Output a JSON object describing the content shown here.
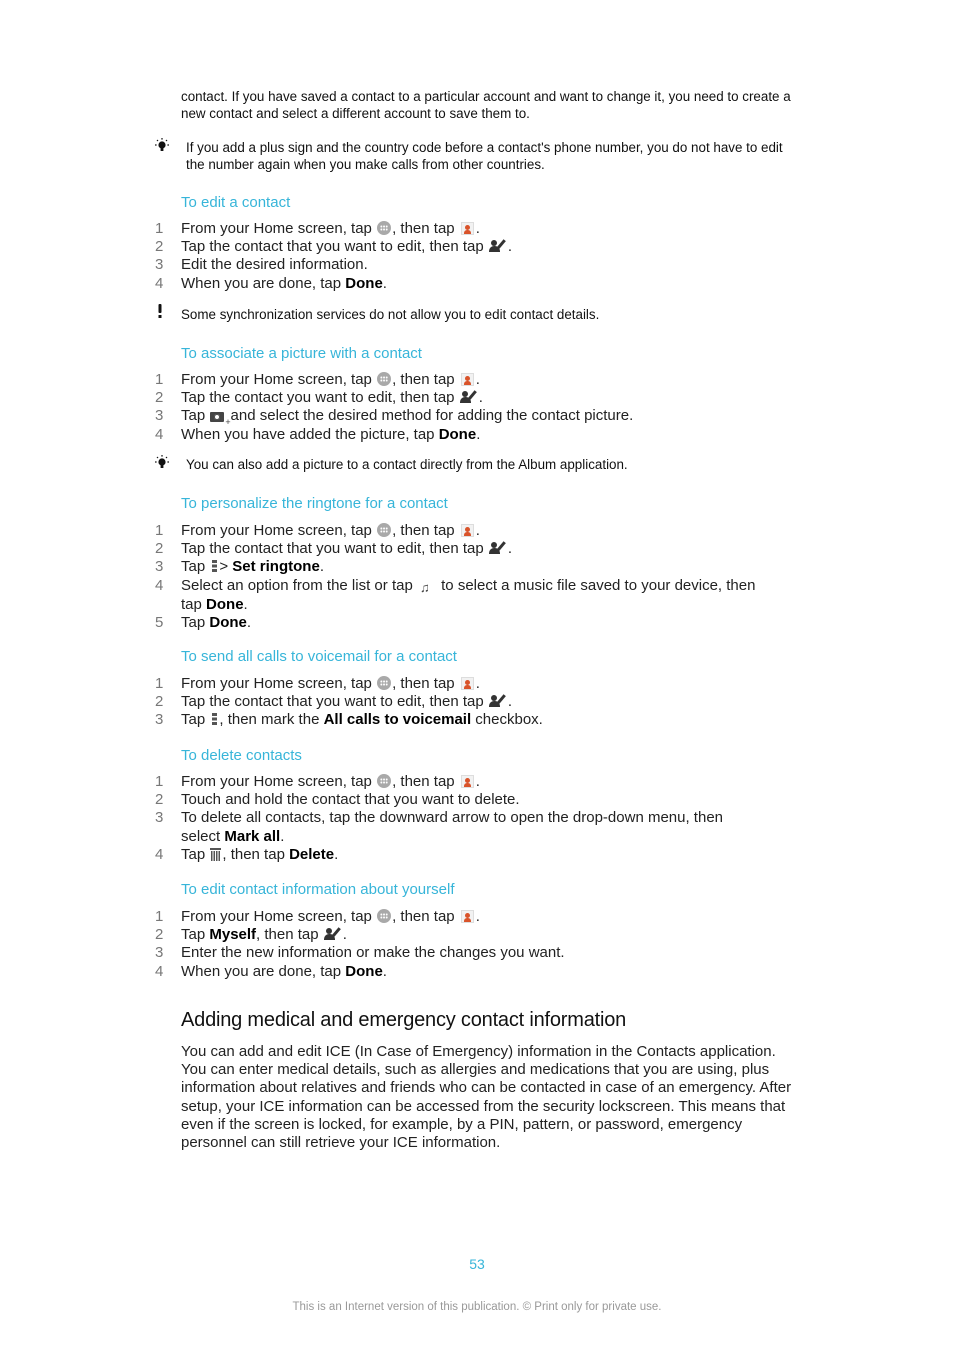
{
  "intro": {
    "text": "contact. If you have saved a contact to a particular account and want to change it, you need to create a new contact and select a different account to save them to."
  },
  "tip1": {
    "icon": "lightbulb-icon",
    "text": "If you add a plus sign and the country code before a contact's phone number, you do not have to edit the number again when you make calls from other countries."
  },
  "sections": [
    {
      "title": "To edit a contact",
      "steps": [
        {
          "num": "1",
          "parts": [
            "From your Home screen, tap ",
            {
              "icon": "apps-icon"
            },
            ", then tap ",
            {
              "icon": "contacts-icon"
            },
            "."
          ]
        },
        {
          "num": "2",
          "parts": [
            "Tap the contact that you want to edit, then tap ",
            {
              "icon": "edit-contact-icon"
            },
            "."
          ]
        },
        {
          "num": "3",
          "parts": [
            "Edit the desired information."
          ]
        },
        {
          "num": "4",
          "parts": [
            "When you are done, tap ",
            {
              "bold": "Done"
            },
            "."
          ]
        }
      ]
    },
    {
      "title": "To associate a picture with a contact",
      "steps": [
        {
          "num": "1",
          "parts": [
            "From your Home screen, tap ",
            {
              "icon": "apps-icon"
            },
            ", then tap ",
            {
              "icon": "contacts-icon"
            },
            "."
          ]
        },
        {
          "num": "2",
          "parts": [
            "Tap the contact you want to edit, then tap ",
            {
              "icon": "edit-contact-icon"
            },
            "."
          ]
        },
        {
          "num": "3",
          "parts": [
            "Tap ",
            {
              "icon": "add-camera-icon"
            },
            " and select the desired method for adding the contact picture."
          ]
        },
        {
          "num": "4",
          "parts": [
            "When you have added the picture, tap ",
            {
              "bold": "Done"
            },
            "."
          ]
        }
      ]
    },
    {
      "title": "To personalize the ringtone for a contact",
      "steps": [
        {
          "num": "1",
          "parts": [
            "From your Home screen, tap ",
            {
              "icon": "apps-icon"
            },
            ", then tap ",
            {
              "icon": "contacts-icon"
            },
            "."
          ]
        },
        {
          "num": "2",
          "parts": [
            "Tap the contact that you want to edit, then tap ",
            {
              "icon": "edit-contact-icon"
            },
            "."
          ]
        },
        {
          "num": "3",
          "parts": [
            "Tap ",
            {
              "icon": "menu-icon"
            },
            "> ",
            {
              "bold": "Set ringtone"
            },
            "."
          ]
        },
        {
          "num": "4",
          "parts": [
            "Select an option from the list or tap ",
            {
              "icon": "music-file-icon"
            },
            " to select a music file saved to your device, then tap ",
            {
              "bold": "Done"
            },
            "."
          ]
        },
        {
          "num": "5",
          "parts": [
            "Tap ",
            {
              "bold": "Done"
            },
            "."
          ]
        }
      ]
    },
    {
      "title": "To send all calls to voicemail for a contact",
      "steps": [
        {
          "num": "1",
          "parts": [
            "From your Home screen, tap ",
            {
              "icon": "apps-icon"
            },
            ", then tap ",
            {
              "icon": "contacts-icon"
            },
            "."
          ]
        },
        {
          "num": "2",
          "parts": [
            "Tap the contact that you want to edit, then tap ",
            {
              "icon": "edit-contact-icon"
            },
            "."
          ]
        },
        {
          "num": "3",
          "parts": [
            "Tap ",
            {
              "icon": "menu-icon"
            },
            ", then mark the ",
            {
              "bold": "All calls to voicemail"
            },
            " checkbox."
          ]
        }
      ]
    },
    {
      "title": "To delete contacts",
      "steps": [
        {
          "num": "1",
          "parts": [
            "From your Home screen, tap ",
            {
              "icon": "apps-icon"
            },
            ", then tap ",
            {
              "icon": "contacts-icon"
            },
            "."
          ]
        },
        {
          "num": "2",
          "parts": [
            "Touch and hold the contact that you want to delete."
          ]
        },
        {
          "num": "3",
          "parts": [
            "To delete all contacts, tap the downward arrow to open the drop-down menu, then select ",
            {
              "bold": "Mark all"
            },
            "."
          ]
        },
        {
          "num": "4",
          "parts": [
            "Tap ",
            {
              "icon": "trash-icon"
            },
            ", then tap ",
            {
              "bold": "Delete"
            },
            "."
          ]
        }
      ]
    },
    {
      "title": "To edit contact information about yourself",
      "steps": [
        {
          "num": "1",
          "parts": [
            "From your Home screen, tap ",
            {
              "icon": "apps-icon"
            },
            ", then tap ",
            {
              "icon": "contacts-icon"
            },
            "."
          ]
        },
        {
          "num": "2",
          "parts": [
            "Tap ",
            {
              "bold": "Myself"
            },
            ", then tap ",
            {
              "icon": "edit-contact-icon"
            },
            "."
          ]
        },
        {
          "num": "3",
          "parts": [
            "Enter the new information or make the changes you want."
          ]
        },
        {
          "num": "4",
          "parts": [
            "When you are done, tap ",
            {
              "bold": "Done"
            },
            "."
          ]
        }
      ]
    }
  ],
  "warning1": {
    "icon": "exclamation-icon",
    "text": "Some synchronization services do not allow you to edit contact details."
  },
  "tip2": {
    "icon": "lightbulb-icon",
    "text": "You can also add a picture to a contact directly from the Album application."
  },
  "ice_section": {
    "heading": "Adding medical and emergency contact information",
    "body": "You can add and edit ICE (In Case of Emergency) information in the Contacts application. You can enter medical details, such as allergies and medications that you are using, plus information about relatives and friends who can be contacted in case of an emergency. After setup, your ICE information can be accessed from the security lockscreen. This means that even if the screen is locked, for example, by a PIN, pattern, or password, emergency personnel can still retrieve your ICE information."
  },
  "footer": {
    "page_number": "53",
    "notice": "This is an Internet version of this publication. © Print only for private use."
  },
  "colors": {
    "accent": "#37b5d9",
    "text": "#222222",
    "step_number": "#777777",
    "footer_text": "#999999"
  }
}
